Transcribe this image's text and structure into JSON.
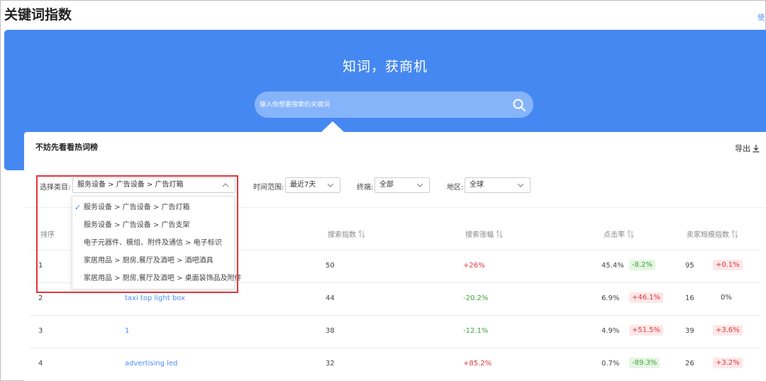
{
  "page": {
    "title": "关键词指数",
    "corner_link": "使"
  },
  "hero": {
    "slogan": "知词，获商机",
    "search_placeholder": "输入你想要搜索的关键词",
    "search_icon": "search-icon"
  },
  "panel": {
    "title": "不妨先看看热词榜",
    "export_label": "导出",
    "export_icon": "download-icon"
  },
  "filters": {
    "category": {
      "label": "选择类目:",
      "value": "服务设备 > 广告设备 > 广告灯箱"
    },
    "time": {
      "label": "时间范围:",
      "value": "最近7天"
    },
    "platform": {
      "label": "终端:",
      "value": "全部"
    },
    "region": {
      "label": "地区:",
      "value": "全球"
    }
  },
  "dropdown": {
    "items": [
      {
        "label": "服务设备 > 广告设备 > 广告灯箱",
        "selected": true
      },
      {
        "label": "服务设备 > 广告设备 > 广告支架",
        "selected": false
      },
      {
        "label": "电子元器件、模组、附件及通信 > 电子标识",
        "selected": false
      },
      {
        "label": "家居用品 > 厨房,餐厅及酒吧 > 酒吧酒具",
        "selected": false
      },
      {
        "label": "家居用品 > 厨房,餐厅及酒吧 > 桌面装饰品及附件",
        "selected": false
      }
    ]
  },
  "table": {
    "headers": {
      "rank": "排序",
      "search_index": "搜索指数",
      "search_growth": "搜索涨幅",
      "ctr": "点击率",
      "seller_index": "卖家规模指数"
    },
    "rows": [
      {
        "rank": "1",
        "keyword": "",
        "search_index": "50",
        "growth": "+26%",
        "ctr": "45.4%",
        "ctr_change": "-8.2%",
        "seller": "95",
        "seller_change": "+0.1%"
      },
      {
        "rank": "2",
        "keyword": "taxi top light box",
        "search_index": "44",
        "growth": "-20.2%",
        "ctr": "6.9%",
        "ctr_change": "+46.1%",
        "seller": "16",
        "seller_change": "0%"
      },
      {
        "rank": "3",
        "keyword": "1",
        "search_index": "38",
        "growth": "-12.1%",
        "ctr": "4.9%",
        "ctr_change": "+51.5%",
        "seller": "39",
        "seller_change": "+3.6%"
      },
      {
        "rank": "4",
        "keyword": "advertising led",
        "search_index": "32",
        "growth": "+85.2%",
        "ctr": "0.7%",
        "ctr_change": "-89.3%",
        "seller": "26",
        "seller_change": "+3.2%"
      }
    ]
  },
  "colors": {
    "accent": "#4688f1",
    "positive": "#e0363d",
    "negative": "#3ca33c",
    "highlight": "#e0363d"
  }
}
